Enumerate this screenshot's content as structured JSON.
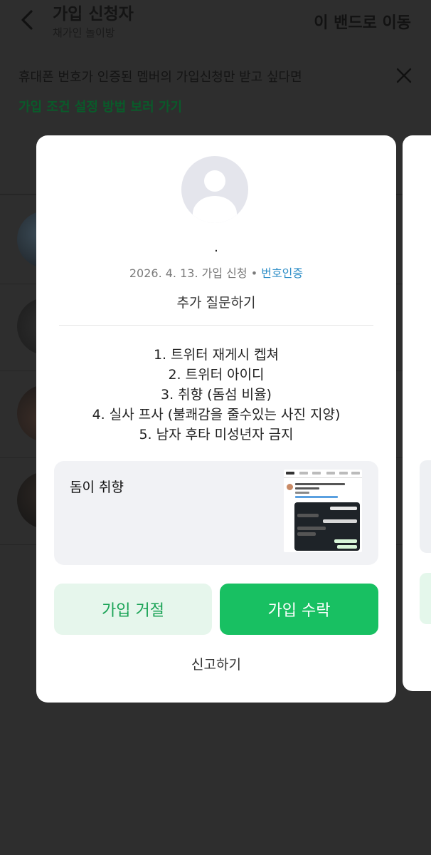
{
  "header": {
    "title": "가입 신청자",
    "subtitle": "채가인 놀이방",
    "goto_label": "이 밴드로 이동"
  },
  "notice": {
    "text": "휴대폰 번호가 인증된 멤버의 가입신청만 받고 싶다면",
    "link": "가입 조건 설정 방법 보러 가기"
  },
  "card": {
    "name": ".",
    "date": "2026. 4. 13. 가입 신청",
    "separator": "•",
    "verified": "번호인증",
    "ask_more": "추가 질문하기",
    "questions": [
      "1. 트위터 재게시 켑쳐",
      "2. 트위터 아이디",
      "3. 취향 (돔섬 비율)",
      "4. 실사 프사 (불쾌감을 줄수있는 사진 지양)",
      "5. 남자 후타 미성년자 금지"
    ],
    "answer": "돔이 취향",
    "reject_label": "가입 거절",
    "accept_label": "가입 수락",
    "report_label": "신고하기"
  },
  "colors": {
    "accent_green": "#18c062",
    "verified_blue": "#2e8ec7",
    "reject_bg": "#e6f6ec"
  },
  "icons": {
    "back": "chevron-left-icon",
    "close": "close-icon",
    "avatar": "default-profile-icon"
  }
}
